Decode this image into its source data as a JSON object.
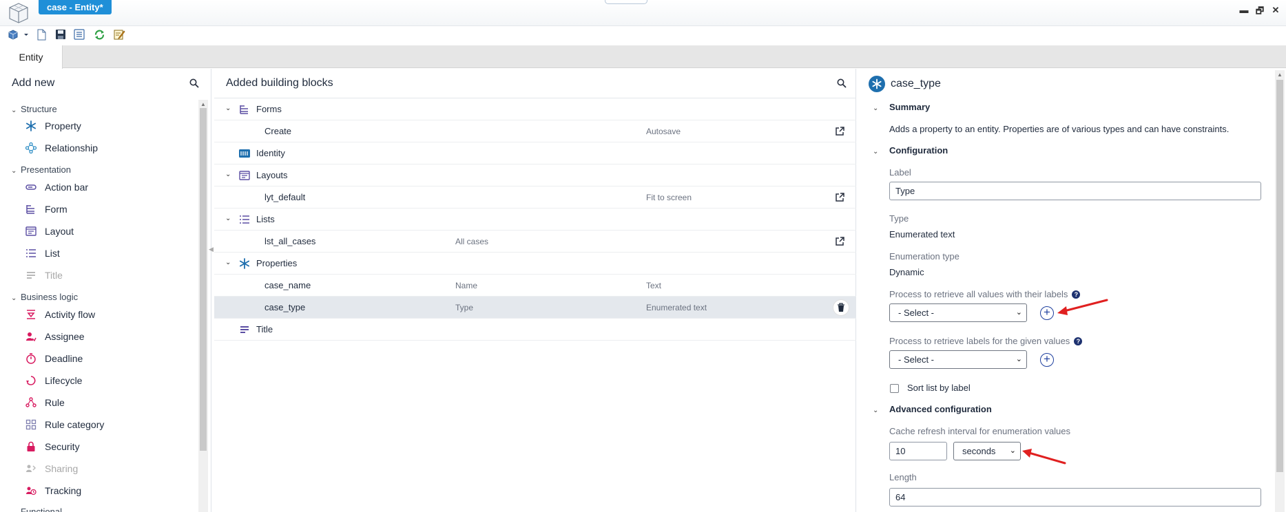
{
  "window": {
    "doc_tab": "case - Entity*",
    "controls": {
      "minimize": "▬",
      "restore": "🗗",
      "close": "✕"
    }
  },
  "toolbar": {
    "icons": [
      "publish-dropdown-icon",
      "new-document-icon",
      "save-icon",
      "save-compare-icon",
      "refresh-icon",
      "edit-notes-icon"
    ]
  },
  "tabs": [
    {
      "label": "Entity",
      "active": true
    }
  ],
  "left_panel": {
    "title": "Add new",
    "groups": {
      "structure": "Structure",
      "presentation": "Presentation",
      "business_logic": "Business logic",
      "functional": "Functional"
    },
    "items": {
      "property": "Property",
      "relationship": "Relationship",
      "action_bar": "Action bar",
      "form": "Form",
      "layout": "Layout",
      "list": "List",
      "title": "Title",
      "activity_flow": "Activity flow",
      "assignee": "Assignee",
      "deadline": "Deadline",
      "lifecycle": "Lifecycle",
      "rule": "Rule",
      "rule_category": "Rule category",
      "security": "Security",
      "sharing": "Sharing",
      "tracking": "Tracking"
    }
  },
  "middle_panel": {
    "title": "Added building blocks",
    "rows": {
      "forms": {
        "label": "Forms"
      },
      "create": {
        "label": "Create",
        "col3": "Autosave"
      },
      "identity": {
        "label": "Identity"
      },
      "layouts": {
        "label": "Layouts"
      },
      "lyt_default": {
        "label": "lyt_default",
        "col3": "Fit to screen"
      },
      "lists": {
        "label": "Lists"
      },
      "lst_all_cases": {
        "label": "lst_all_cases",
        "col2": "All cases"
      },
      "properties": {
        "label": "Properties"
      },
      "case_name": {
        "label": "case_name",
        "col2": "Name",
        "col3": "Text"
      },
      "case_type": {
        "label": "case_type",
        "col2": "Type",
        "col3": "Enumerated text",
        "selected": true
      },
      "title": {
        "label": "Title"
      }
    }
  },
  "right_panel": {
    "title": "case_type",
    "summary": {
      "heading": "Summary",
      "text": "Adds a property to an entity. Properties are of various types and can have constraints."
    },
    "configuration": {
      "heading": "Configuration",
      "label_caption": "Label",
      "label_value": "Type",
      "type_caption": "Type",
      "type_value": "Enumerated text",
      "enum_caption": "Enumeration type",
      "enum_value": "Dynamic",
      "process_all_caption": "Process to retrieve all values with their labels",
      "process_all_value": "- Select -",
      "process_labels_caption": "Process to retrieve labels for the given values",
      "process_labels_value": "- Select -",
      "sort_label": "Sort list by label",
      "sort_checked": false,
      "help_glyph": "?",
      "plus_glyph": "+"
    },
    "advanced": {
      "heading": "Advanced configuration",
      "cache_caption": "Cache refresh interval for enumeration values",
      "cache_value": "10",
      "cache_unit": "seconds",
      "length_caption": "Length",
      "length_value": "64"
    }
  },
  "colors": {
    "accent": "#1f8fd8",
    "selected_row": "#e4e8ed",
    "annotation_arrow": "#e02020",
    "property_icon": "#1e6fae"
  }
}
